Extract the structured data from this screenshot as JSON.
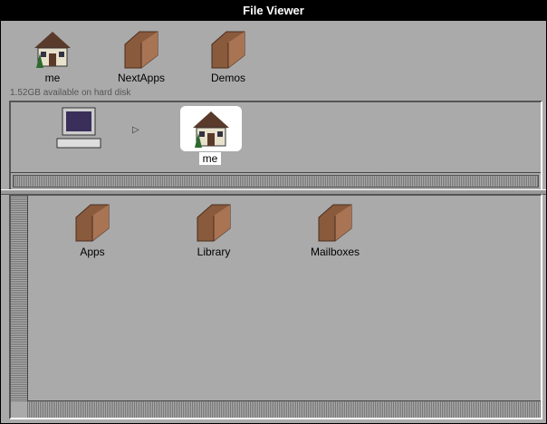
{
  "window": {
    "title": "File Viewer"
  },
  "shelf": [
    {
      "label": "me",
      "icon": "house-icon"
    },
    {
      "label": "NextApps",
      "icon": "folder-icon"
    },
    {
      "label": "Demos",
      "icon": "folder-icon"
    }
  ],
  "disk_info": "1.52GB available on hard disk",
  "browser": {
    "root_icon": "computer-icon",
    "selected_label": "me"
  },
  "files": [
    {
      "label": "Apps",
      "icon": "folder-icon"
    },
    {
      "label": "Library",
      "icon": "folder-icon"
    },
    {
      "label": "Mailboxes",
      "icon": "folder-icon"
    }
  ],
  "colors": {
    "window_bg": "#aaaaaa",
    "titlebar": "#000000",
    "folder_brown": "#8a5a3c"
  }
}
